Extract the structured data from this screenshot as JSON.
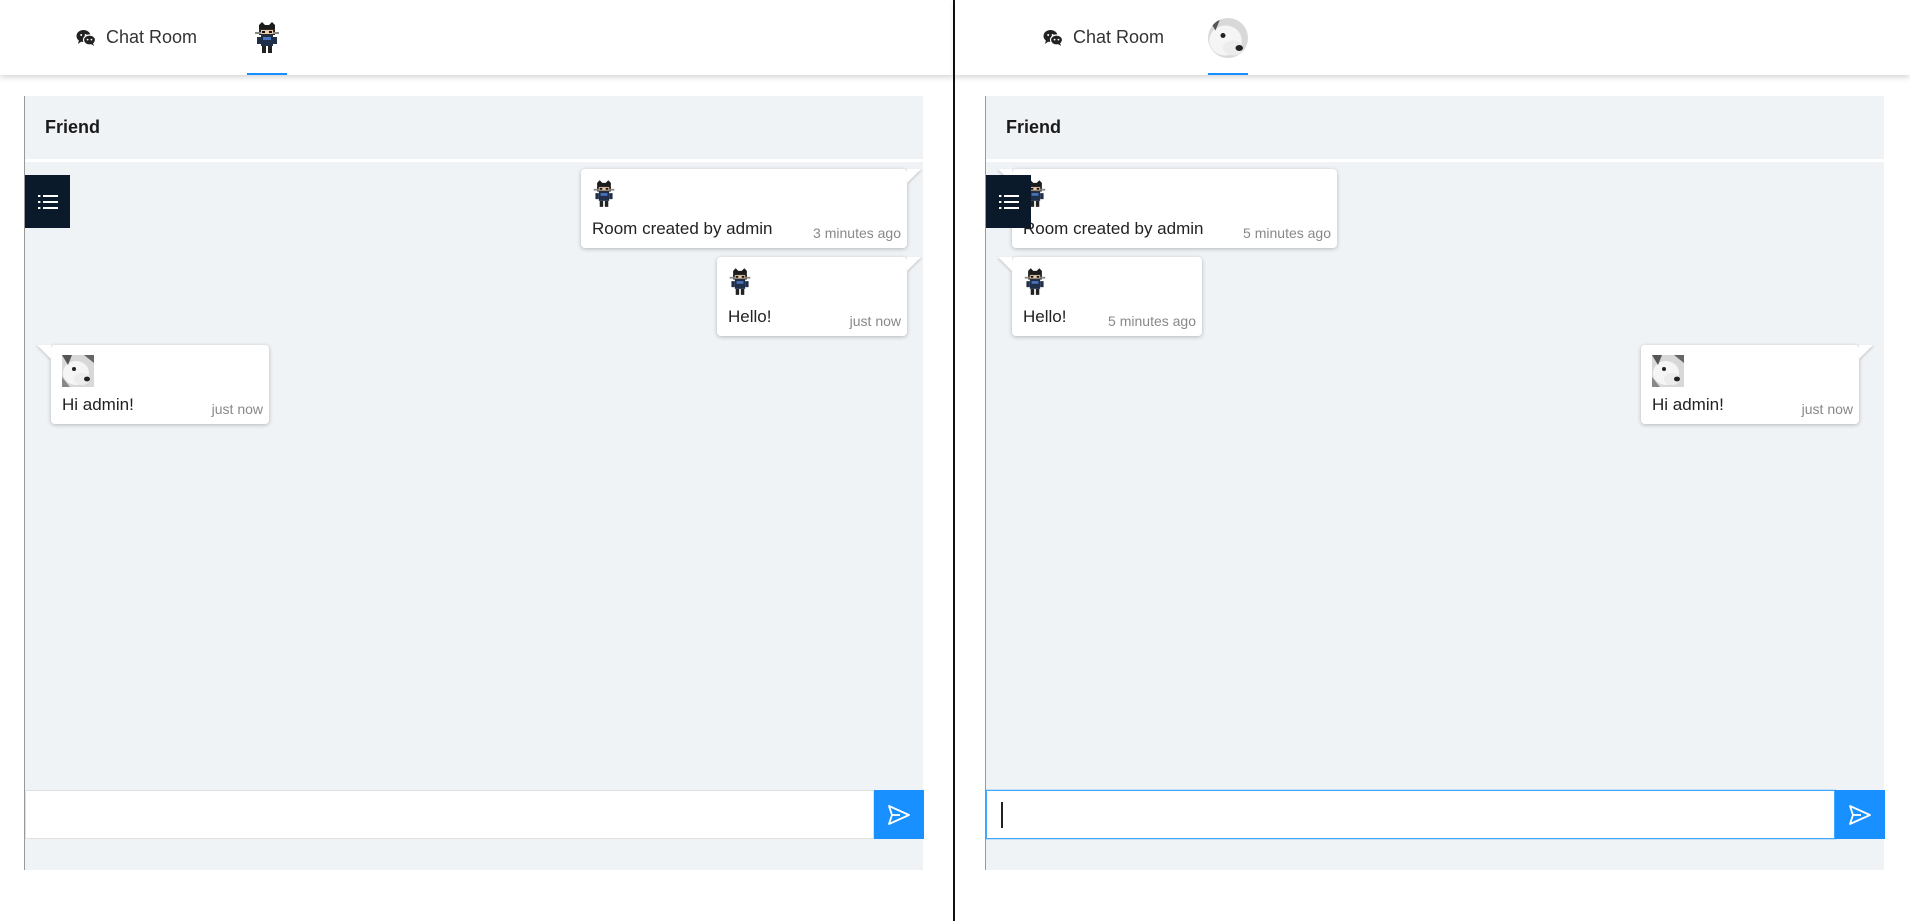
{
  "divider_color": "#111111",
  "accent": "#1890ff",
  "panes": {
    "left": {
      "nav": {
        "room_label": "Chat Room",
        "room_icon": "wechat-icon",
        "avatar": "ninja-avatar"
      },
      "chat": {
        "header": "Friend",
        "input": {
          "value": "",
          "placeholder": ""
        },
        "messages": [
          {
            "sender": "admin",
            "avatar": "ninja-avatar",
            "text": "Room created by admin",
            "time": "3 minutes ago",
            "side": "right"
          },
          {
            "sender": "admin",
            "avatar": "ninja-avatar",
            "text": "Hello!",
            "time": "just now",
            "side": "right"
          },
          {
            "sender": "friend",
            "avatar": "dog-avatar",
            "text": "Hi admin!",
            "time": "just now",
            "side": "left"
          }
        ]
      }
    },
    "right": {
      "nav": {
        "room_label": "Chat Room",
        "room_icon": "wechat-icon",
        "avatar": "dog-avatar"
      },
      "chat": {
        "header": "Friend",
        "input": {
          "value": "",
          "placeholder": ""
        },
        "messages": [
          {
            "sender": "admin",
            "avatar": "ninja-avatar",
            "text": "Room created by admin",
            "time": "5 minutes ago",
            "side": "left"
          },
          {
            "sender": "admin",
            "avatar": "ninja-avatar",
            "text": "Hello!",
            "time": "5 minutes ago",
            "side": "left"
          },
          {
            "sender": "friend",
            "avatar": "dog-avatar",
            "text": "Hi admin!",
            "time": "just now",
            "side": "right"
          }
        ]
      }
    }
  }
}
